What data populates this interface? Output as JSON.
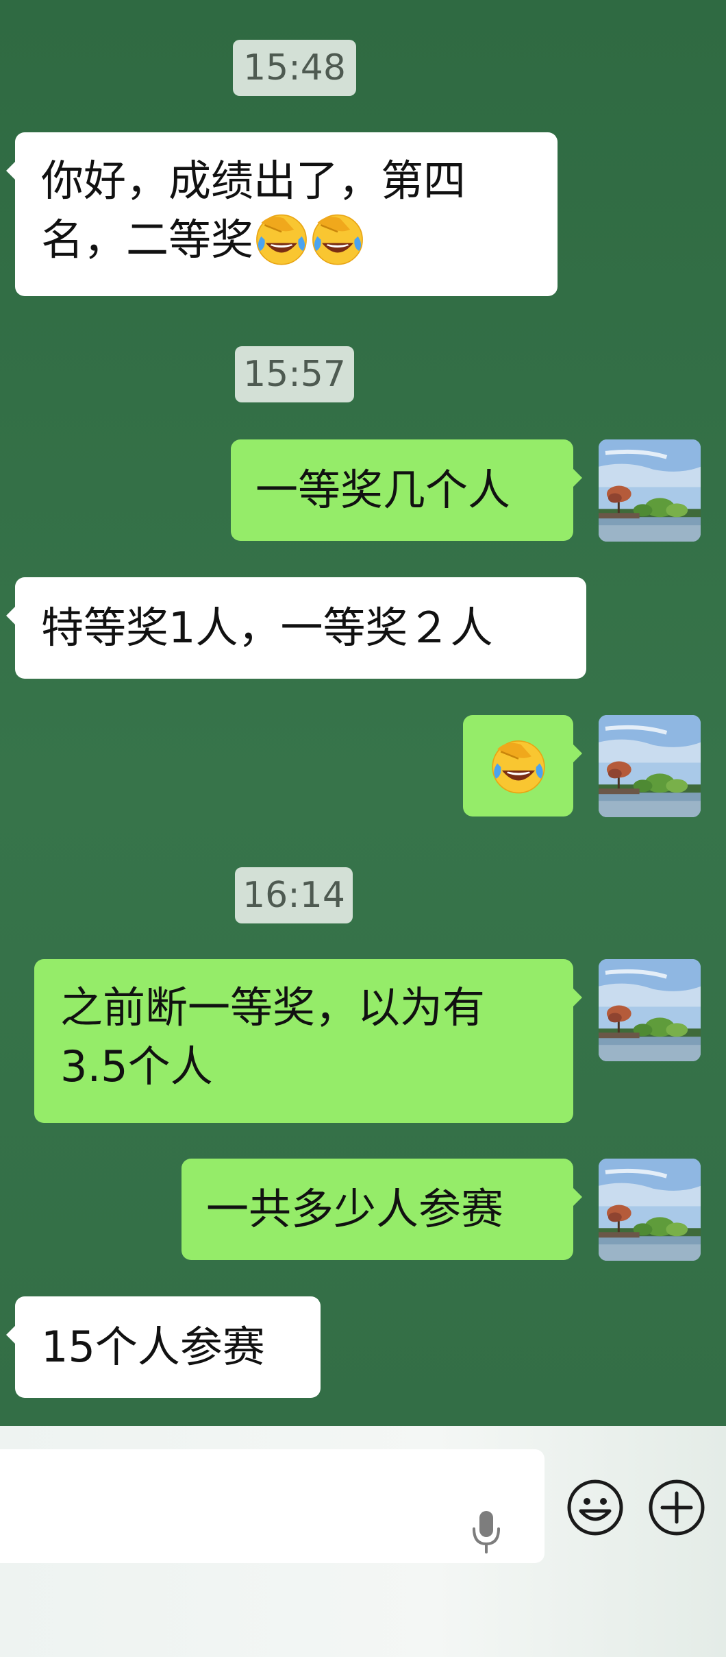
{
  "messages": {
    "ts1": "15:48",
    "m1": {
      "line1": "你好，成绩出了，第四",
      "line2": "名，二等奖"
    },
    "ts2": "15:57",
    "m2": "一等奖几个人",
    "m3": "特等奖1人，一等奖２人",
    "ts3": "16:14",
    "m5": {
      "line1": "之前断一等奖，以为有",
      "line2": "3.5个人"
    },
    "m6": "一共多少人参赛",
    "m7": "15个人参赛"
  },
  "icons": {
    "emoji": "facepalm-laughing-emoji",
    "voice": "microphone-icon",
    "sticker": "smiley-icon",
    "more": "plus-circle-icon"
  },
  "colors": {
    "background": "#346d45",
    "incoming_bubble": "#ffffff",
    "outgoing_bubble": "#95ec69",
    "timestamp_bg": "#d3e0d6"
  }
}
